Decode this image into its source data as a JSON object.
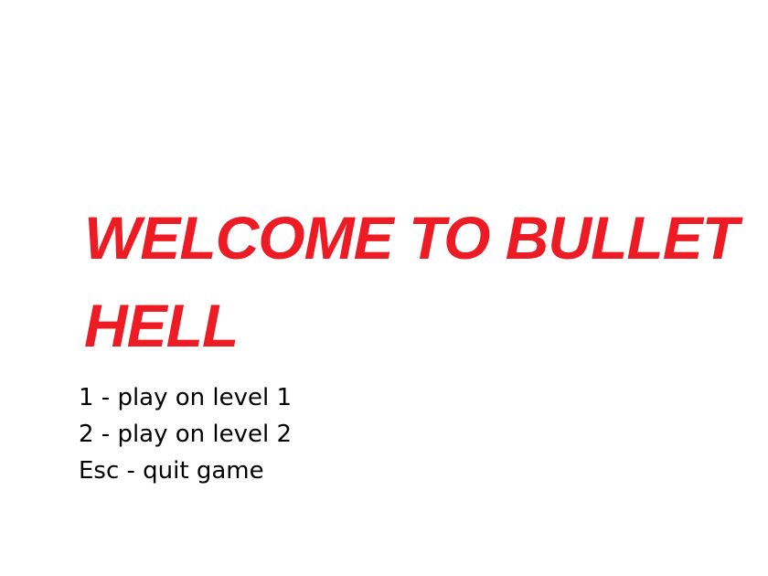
{
  "title": {
    "line1": "WELCOME TO BULLET",
    "line2": "HELL"
  },
  "menu": {
    "items": [
      {
        "label": "1 - play on level 1"
      },
      {
        "label": "2 - play on level 2"
      },
      {
        "label": "Esc - quit game"
      }
    ]
  },
  "colors": {
    "title": "#ed1c24",
    "text": "#000000",
    "background": "#ffffff"
  }
}
